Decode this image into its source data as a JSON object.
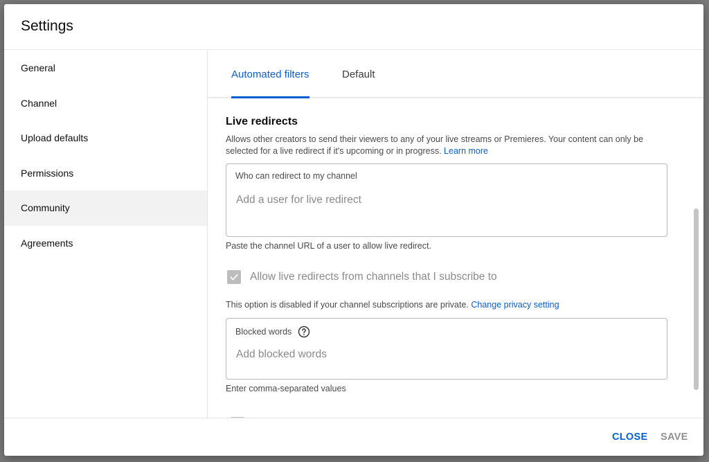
{
  "dialog": {
    "title": "Settings"
  },
  "sidebar": {
    "items": [
      {
        "label": "General"
      },
      {
        "label": "Channel"
      },
      {
        "label": "Upload defaults"
      },
      {
        "label": "Permissions"
      },
      {
        "label": "Community",
        "active": true
      },
      {
        "label": "Agreements"
      }
    ]
  },
  "tabs": [
    {
      "label": "Automated filters",
      "active": true
    },
    {
      "label": "Default"
    }
  ],
  "live_redirects": {
    "title": "Live redirects",
    "description": "Allows other creators to send their viewers to any of your live streams or Premieres. Your content can only be selected for a live redirect if it's upcoming or in progress.",
    "learn_more": "Learn more",
    "field_label": "Who can redirect to my channel",
    "field_placeholder": "Add a user for live redirect",
    "field_value": "",
    "helper": "Paste the channel URL of a user to allow live redirect.",
    "checkbox_label": "Allow live redirects from channels that I subscribe to",
    "checkbox_checked": true,
    "checkbox_disabled": true,
    "disabled_note": "This option is disabled if your channel subscriptions are private.",
    "change_privacy": "Change privacy setting"
  },
  "blocked_words": {
    "field_label": "Blocked words",
    "help_icon": "help-circle-icon",
    "field_placeholder": "Add blocked words",
    "field_value": "",
    "helper": "Enter comma-separated values"
  },
  "footer": {
    "close_label": "CLOSE",
    "save_label": "SAVE"
  },
  "colors": {
    "accent": "#065fd4",
    "disabled": "#909090",
    "active_bg": "#f2f2f2"
  }
}
